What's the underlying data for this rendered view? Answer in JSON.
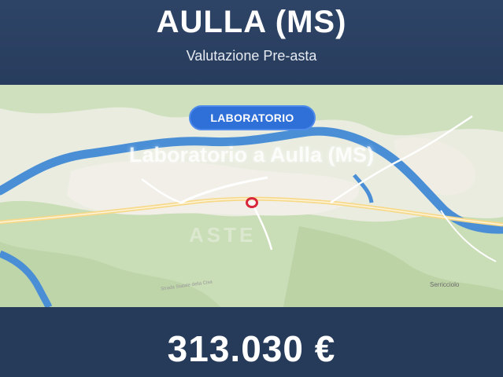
{
  "header": {
    "title": "AULLA (MS)",
    "subtitle": "Valutazione Pre-asta"
  },
  "map": {
    "badge_label": "LABORATORIO",
    "caption": "Laboratorio a Aulla (MS)",
    "place_label": "Serricciolo",
    "street_label": "Strada Statale della Cisa",
    "marker_color": "#d8263a",
    "river_color": "#4a8fd6"
  },
  "footer": {
    "price": "313.030 €"
  },
  "colors": {
    "background": "#273c5c",
    "badge": "#2f6fd8"
  }
}
